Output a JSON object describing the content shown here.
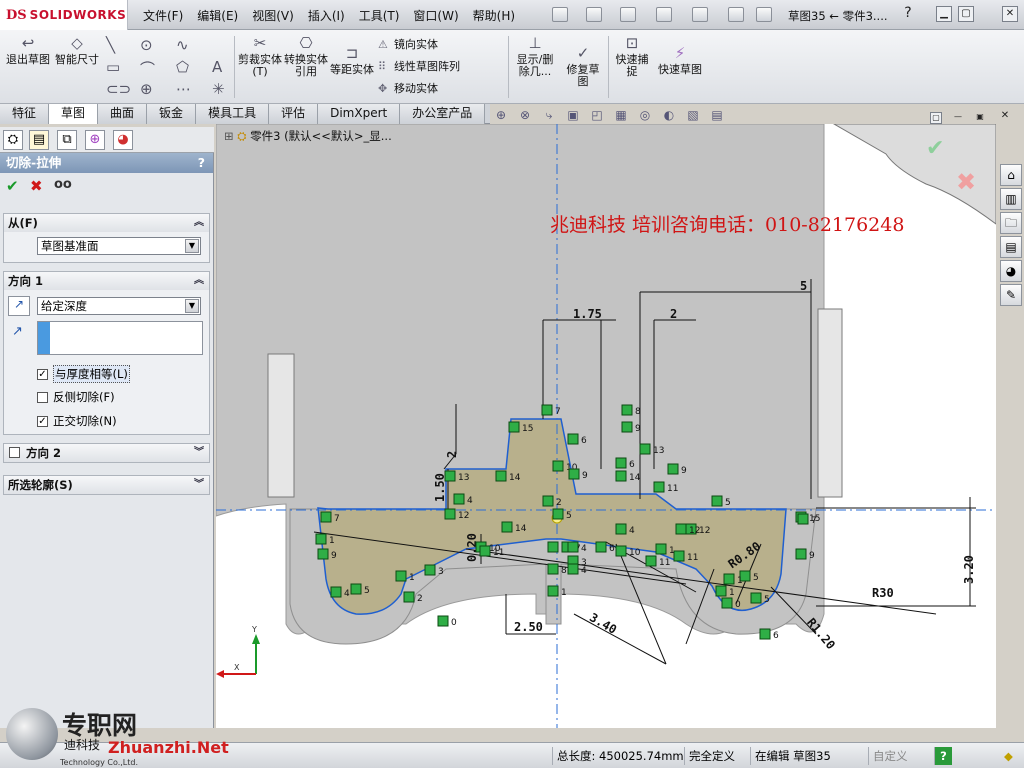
{
  "app": {
    "brand": "SOLIDWORKS",
    "document_title": "草图35 ← 零件3...."
  },
  "menu": [
    "文件(F)",
    "编辑(E)",
    "视图(V)",
    "插入(I)",
    "工具(T)",
    "窗口(W)",
    "帮助(H)"
  ],
  "toolbar": {
    "exit_sketch": "退出草图",
    "smart_dimension": "智能尺寸",
    "trim_entities": "剪裁实体(T)",
    "convert_entities": "转换实体引用",
    "offset_entities": "等距实体",
    "mirror_entities": "镜向实体",
    "linear_pattern": "线性草图阵列",
    "move_entities": "移动实体",
    "display_delete_relations": "显示/删除几...",
    "repair_sketch": "修复草图",
    "quick_snaps": "快速捕捉",
    "rapid_sketch": "快速草图"
  },
  "tabs": [
    {
      "label": "特征",
      "active": false
    },
    {
      "label": "草图",
      "active": true
    },
    {
      "label": "曲面",
      "active": false
    },
    {
      "label": "钣金",
      "active": false
    },
    {
      "label": "模具工具",
      "active": false
    },
    {
      "label": "评估",
      "active": false
    },
    {
      "label": "DimXpert",
      "active": false
    },
    {
      "label": "办公室产品",
      "active": false
    }
  ],
  "feature_tree_flyout": "零件3   (默认<<默认>_显...",
  "property_manager": {
    "title": "切除-拉伸",
    "help": "?",
    "from": {
      "label": "从(F)",
      "value": "草图基准面"
    },
    "direction1": {
      "label": "方向 1",
      "end_condition": "给定深度",
      "equal_thickness": "与厚度相等(L)",
      "flip_side": "反侧切除(F)",
      "normal_cut": "正交切除(N)"
    },
    "direction2": {
      "label": "方向 2"
    },
    "selected_contours": {
      "label": "所选轮廓(S)"
    }
  },
  "overlay_text": "兆迪科技     培训咨询电话：010-82176248",
  "dimensions": {
    "d1": "1.75",
    "d2": "2",
    "d3": "5",
    "d4": "2",
    "d5": "1.50",
    "d6": "0.20",
    "d7": "2.50",
    "d8": "3.40",
    "d9": "R0.80",
    "d10": "R30",
    "d11": "R1.20",
    "d12": "3.20"
  },
  "relation_numbers": [
    "7",
    "8",
    "15",
    "9",
    "6",
    "13",
    "9",
    "10",
    "6",
    "11",
    "9",
    "13",
    "14",
    "14",
    "5",
    "7",
    "2",
    "12",
    "4",
    "5",
    "10",
    "8",
    "7",
    "15",
    "4",
    "12",
    "11",
    "14",
    "4",
    "1",
    "8",
    "3",
    "1",
    "5",
    "10",
    "1",
    "6",
    "3",
    "4",
    "1",
    "0",
    "12",
    "11",
    "11",
    "1",
    "9",
    "5",
    "2",
    "0",
    "4",
    "6",
    "1",
    "5",
    "7",
    "9"
  ],
  "status": {
    "total_length": "总长度: 450025.74mm",
    "fully_defined": "完全定义",
    "editing": "在编辑 草图35",
    "custom": "自定义"
  },
  "watermark": {
    "brand": "专职网",
    "url": "Zhuanzhi.Net",
    "sub": "迪科技",
    "tiny": "Technology Co.,Ltd."
  },
  "colors": {
    "accent_red": "#c8102e",
    "relation_green": "#2fae46",
    "sketch_blue": "#1f5fd0",
    "fill_khaki": "#b8b08c"
  }
}
